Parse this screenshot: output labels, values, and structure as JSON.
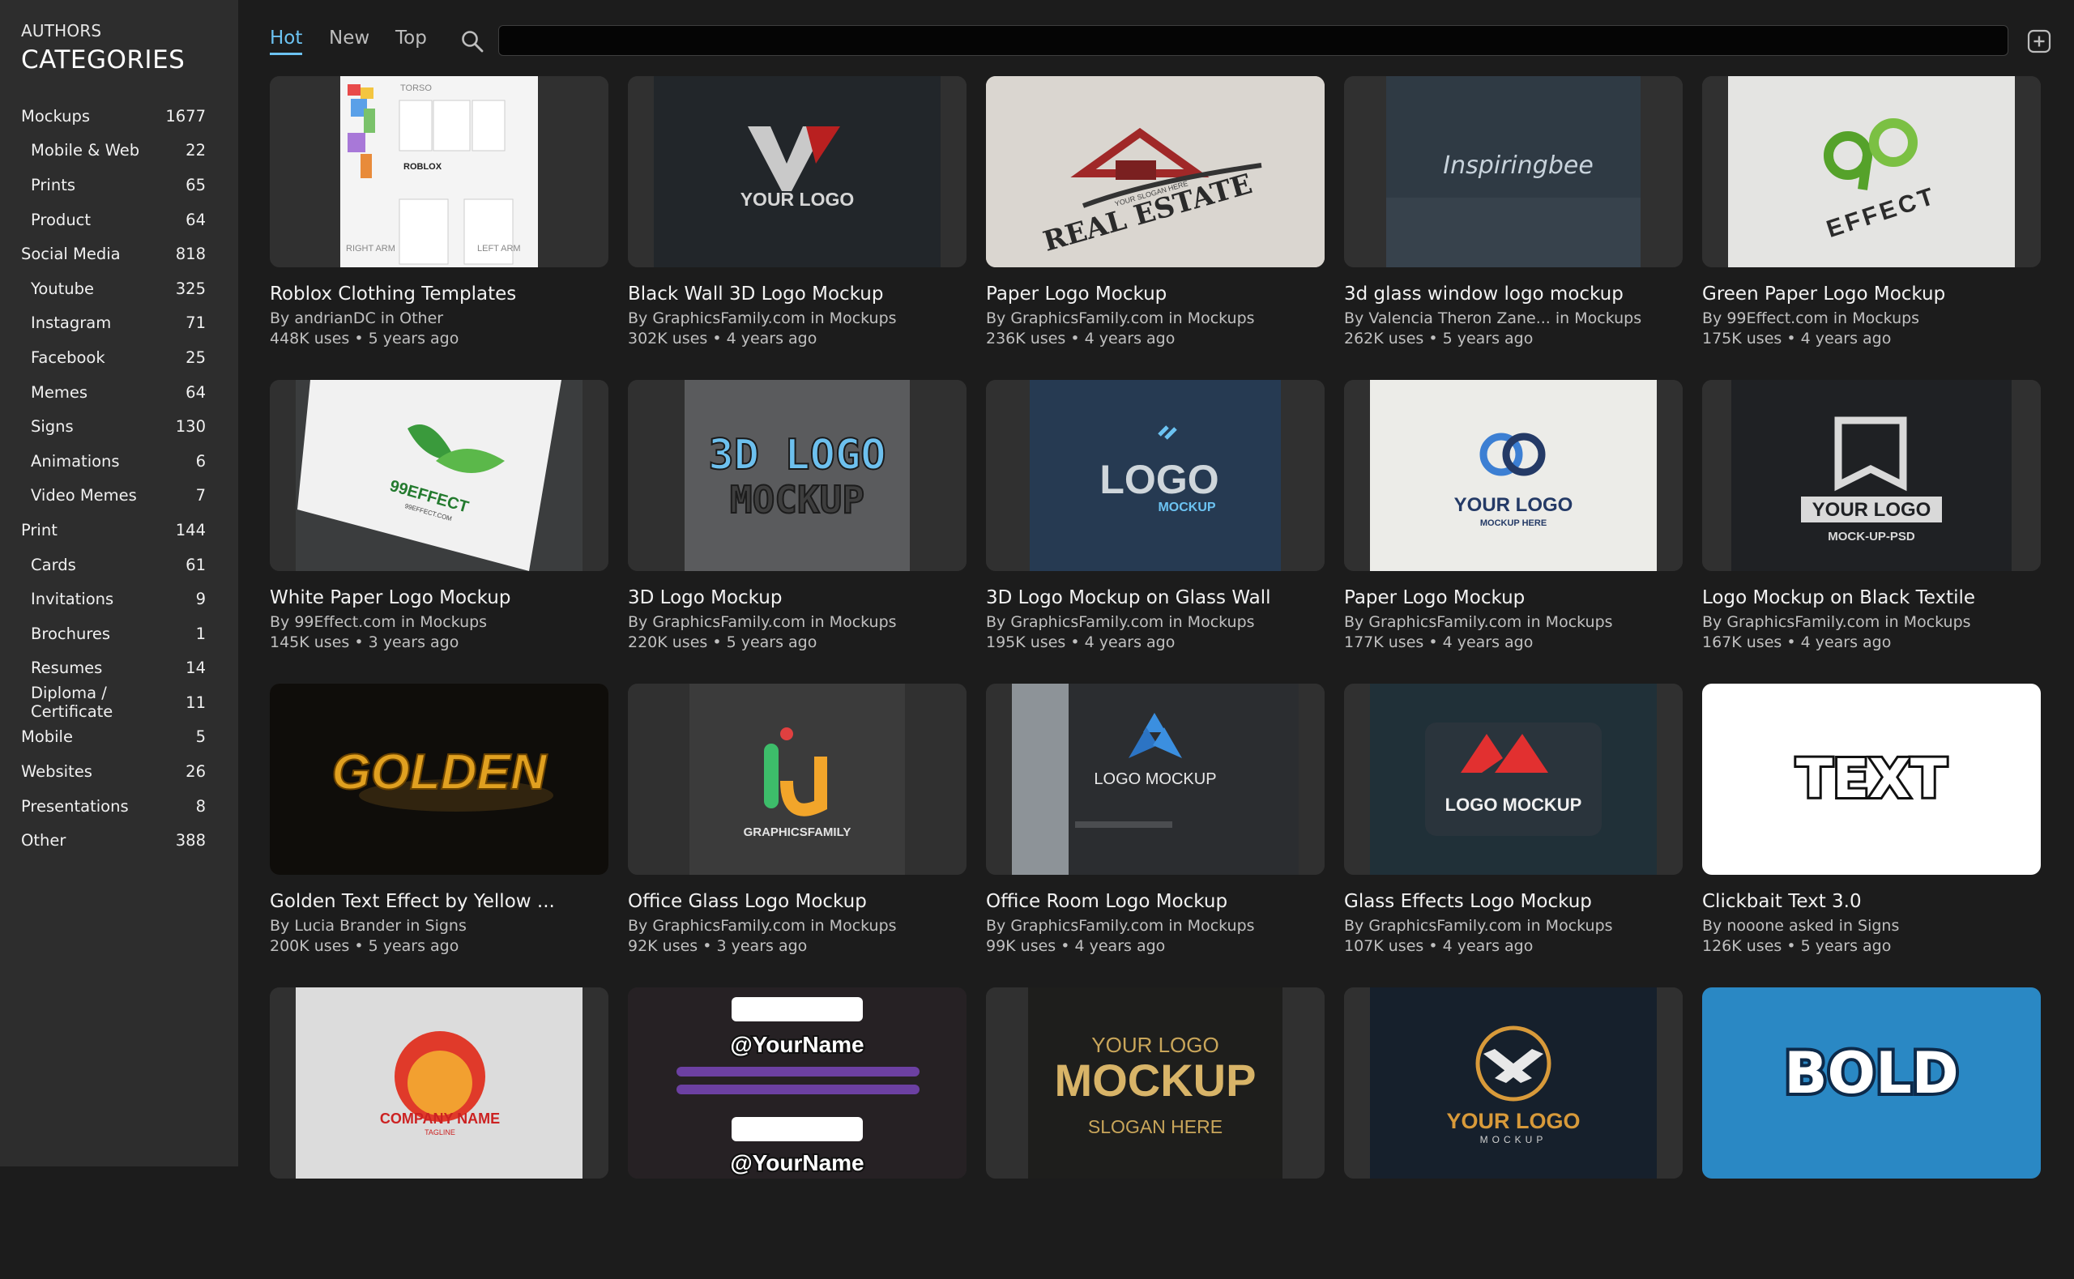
{
  "sidebar": {
    "authors_label": "AUTHORS",
    "categories_title": "CATEGORIES",
    "items": [
      {
        "label": "Mockups",
        "count": "1677",
        "level": "top"
      },
      {
        "label": "Mobile & Web",
        "count": "22",
        "level": "sub"
      },
      {
        "label": "Prints",
        "count": "65",
        "level": "sub"
      },
      {
        "label": "Product",
        "count": "64",
        "level": "sub"
      },
      {
        "label": "Social Media",
        "count": "818",
        "level": "top"
      },
      {
        "label": "Youtube",
        "count": "325",
        "level": "sub"
      },
      {
        "label": "Instagram",
        "count": "71",
        "level": "sub"
      },
      {
        "label": "Facebook",
        "count": "25",
        "level": "sub"
      },
      {
        "label": "Memes",
        "count": "64",
        "level": "sub"
      },
      {
        "label": "Signs",
        "count": "130",
        "level": "sub"
      },
      {
        "label": "Animations",
        "count": "6",
        "level": "sub"
      },
      {
        "label": "Video Memes",
        "count": "7",
        "level": "sub"
      },
      {
        "label": "Print",
        "count": "144",
        "level": "top"
      },
      {
        "label": "Cards",
        "count": "61",
        "level": "sub"
      },
      {
        "label": "Invitations",
        "count": "9",
        "level": "sub"
      },
      {
        "label": "Brochures",
        "count": "1",
        "level": "sub"
      },
      {
        "label": "Resumes",
        "count": "14",
        "level": "sub"
      },
      {
        "label": "Diploma / Certificate",
        "count": "11",
        "level": "sub"
      },
      {
        "label": "Mobile",
        "count": "5",
        "level": "top"
      },
      {
        "label": "Websites",
        "count": "26",
        "level": "top"
      },
      {
        "label": "Presentations",
        "count": "8",
        "level": "top"
      },
      {
        "label": "Other",
        "count": "388",
        "level": "top"
      }
    ]
  },
  "tabs": [
    {
      "label": "Hot",
      "active": true
    },
    {
      "label": "New",
      "active": false
    },
    {
      "label": "Top",
      "active": false
    }
  ],
  "search": {
    "value": "",
    "placeholder": ""
  },
  "icons": {
    "search": "search-icon",
    "add": "plus-square-icon"
  },
  "colors": {
    "accent": "#6cc3f2",
    "sidebar_bg": "#2d2d2d",
    "page_bg": "#1c1c1c"
  },
  "cards": [
    {
      "title": "Roblox Clothing Templates",
      "by": "By andrianDC in Other",
      "uses": "448K uses • 5 years ago",
      "thumb": "roblox",
      "art": [
        "TORSO",
        "ROBLOX",
        "RIGHT ARM",
        "LEFT ARM"
      ]
    },
    {
      "title": "Black Wall 3D Logo Mockup",
      "by": "By GraphicsFamily.com in Mockups",
      "uses": "302K uses • 4 years ago",
      "thumb": "blackwall",
      "art": [
        "YOUR LOGO"
      ]
    },
    {
      "title": "Paper Logo Mockup",
      "by": "By GraphicsFamily.com in Mockups",
      "uses": "236K uses • 4 years ago",
      "thumb": "realestate",
      "art": [
        "REAL ESTATE",
        "YOUR SLOGAN HERE"
      ]
    },
    {
      "title": "3d glass window logo mockup",
      "by": "By Valencia Theron Zane... in Mockups",
      "uses": "262K uses • 5 years ago",
      "thumb": "glasswindow",
      "art": [
        "Inspiringbee"
      ]
    },
    {
      "title": "Green Paper Logo Mockup",
      "by": "By 99Effect.com in Mockups",
      "uses": "175K uses • 4 years ago",
      "thumb": "greenpaper",
      "art": [
        "EFFECT"
      ]
    },
    {
      "title": "White Paper Logo Mockup",
      "by": "By 99Effect.com in Mockups",
      "uses": "145K uses • 3 years ago",
      "thumb": "whitepaper",
      "art": [
        "99EFFECT",
        "99EFFECT.COM"
      ]
    },
    {
      "title": "3D Logo Mockup",
      "by": "By GraphicsFamily.com in Mockups",
      "uses": "220K uses • 5 years ago",
      "thumb": "3dlogo",
      "art": [
        "3D LOGO",
        "MOCKUP"
      ]
    },
    {
      "title": "3D Logo Mockup on Glass Wall",
      "by": "By GraphicsFamily.com in Mockups",
      "uses": "195K uses • 4 years ago",
      "thumb": "glasswall",
      "art": [
        "LOGO",
        "MOCKUP"
      ]
    },
    {
      "title": "Paper Logo Mockup",
      "by": "By GraphicsFamily.com in Mockups",
      "uses": "177K uses • 4 years ago",
      "thumb": "paperlogo2",
      "art": [
        "YOUR LOGO",
        "MOCKUP HERE"
      ]
    },
    {
      "title": "Logo Mockup on Black Textile",
      "by": "By GraphicsFamily.com in Mockups",
      "uses": "167K uses • 4 years ago",
      "thumb": "blacktextile",
      "art": [
        "YOUR LOGO",
        "MOCK-UP-PSD"
      ]
    },
    {
      "title": "Golden Text Effect by Yellow ...",
      "by": "By Lucia Brander in Signs",
      "uses": "200K uses • 5 years ago",
      "thumb": "golden",
      "art": [
        "GOLDEN"
      ]
    },
    {
      "title": "Office Glass Logo Mockup",
      "by": "By GraphicsFamily.com in Mockups",
      "uses": "92K uses • 3 years ago",
      "thumb": "officeglass",
      "art": [
        "GRAPHICSFAMILY"
      ]
    },
    {
      "title": "Office Room Logo Mockup",
      "by": "By GraphicsFamily.com in Mockups",
      "uses": "99K uses • 4 years ago",
      "thumb": "officeroom",
      "art": [
        "LOGO MOCKUP"
      ]
    },
    {
      "title": "Glass Effects Logo Mockup",
      "by": "By GraphicsFamily.com in Mockups",
      "uses": "107K uses • 4 years ago",
      "thumb": "glasseffects",
      "art": [
        "LOGO MOCKUP"
      ]
    },
    {
      "title": "Clickbait Text 3.0",
      "by": "By nooone asked in Signs",
      "uses": "126K uses • 5 years ago",
      "thumb": "clickbait",
      "art": [
        "TEXT"
      ]
    },
    {
      "title": "",
      "by": "",
      "uses": "",
      "thumb": "companyname",
      "art": [
        "COMPANY NAME",
        "TAGLINE"
      ]
    },
    {
      "title": "",
      "by": "",
      "uses": "",
      "thumb": "yourname",
      "art": [
        "@YourName",
        "@YourName"
      ]
    },
    {
      "title": "",
      "by": "",
      "uses": "",
      "thumb": "goldmockup",
      "art": [
        "YOUR LOGO",
        "MOCKUP",
        "SLOGAN HERE"
      ]
    },
    {
      "title": "",
      "by": "",
      "uses": "",
      "thumb": "yourlogo5",
      "art": [
        "YOUR LOGO",
        "MOCKUP"
      ]
    },
    {
      "title": "",
      "by": "",
      "uses": "",
      "thumb": "bold",
      "art": [
        "BOLD"
      ]
    }
  ]
}
